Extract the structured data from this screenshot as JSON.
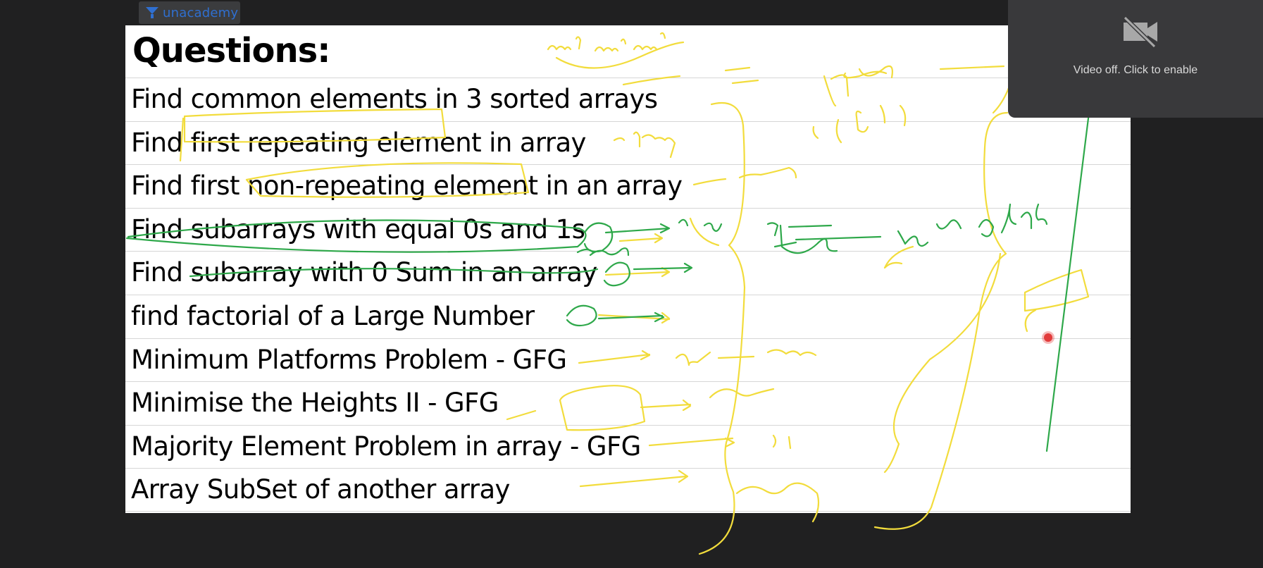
{
  "brand": {
    "name": "unacademy"
  },
  "slide": {
    "title": "Questions:",
    "questions": [
      "Find common elements in 3 sorted arrays",
      "Find first repeating element in array",
      "Find first non-repeating element in an array",
      "Find subarrays with equal 0s and 1s",
      "Find subarray with 0 Sum in an array",
      "find factorial of a Large Number",
      "Minimum Platforms Problem - GFG",
      "Minimise the Heights II - GFG",
      "Majority Element Problem in array - GFG",
      "Array SubSet of another array"
    ]
  },
  "video": {
    "status_text": "Video off. Click to enable",
    "icon": "video-off-icon"
  },
  "colors": {
    "ink_yellow": "#f2dc3c",
    "ink_green": "#2ea84a",
    "background": "#202021",
    "panel": "#39393b"
  }
}
